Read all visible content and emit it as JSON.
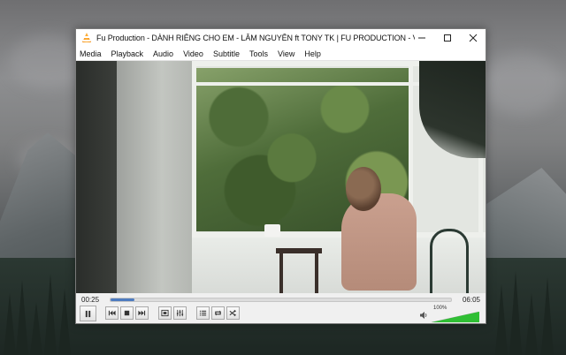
{
  "window": {
    "title": "Fu Production - DÀNH RIÊNG CHO EM - LÂM NGUYÊN ft TONY TK | FU PRODUCTION - VLC medi..."
  },
  "menu": {
    "items": [
      "Media",
      "Playback",
      "Audio",
      "Video",
      "Subtitle",
      "Tools",
      "View",
      "Help"
    ]
  },
  "player": {
    "elapsed": "00:25",
    "total": "06:05",
    "progress_fraction": 0.07,
    "volume_label": "100%",
    "volume_fraction": 1.0
  },
  "icons": {
    "title": "vlc-cone-icon",
    "window": [
      "minimize-icon",
      "maximize-icon",
      "close-icon"
    ],
    "controls": [
      "pause-icon",
      "previous-icon",
      "stop-icon",
      "next-icon",
      "fullscreen-icon",
      "extended-settings-icon",
      "playlist-icon",
      "loop-icon",
      "shuffle-icon",
      "speaker-icon"
    ]
  },
  "colors": {
    "seek_fill": "#4d7bbf",
    "volume_fill": "#2fbf34",
    "vlc_orange": "#f28a0c"
  }
}
